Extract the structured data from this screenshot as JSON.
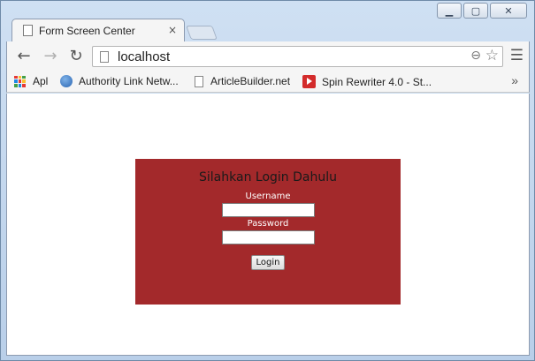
{
  "browser": {
    "tab_title": "Form Screen Center",
    "tab_close": "×",
    "url": "localhost",
    "bookmarks": [
      {
        "label": "Apl",
        "icon": "apps-grid-icon"
      },
      {
        "label": "Authority Link Netw...",
        "icon": "globe-icon"
      },
      {
        "label": "ArticleBuilder.net",
        "icon": "page-icon"
      },
      {
        "label": "Spin Rewriter 4.0 - St...",
        "icon": "spin-rewriter-icon"
      }
    ],
    "bookmarks_more": "»"
  },
  "login": {
    "heading": "Silahkan Login Dahulu",
    "username_label": "Username",
    "password_label": "Password",
    "username_value": "",
    "password_value": "",
    "button_label": "Login"
  },
  "colors": {
    "login_panel": "#a3292b",
    "label_text": "#ffffff"
  }
}
